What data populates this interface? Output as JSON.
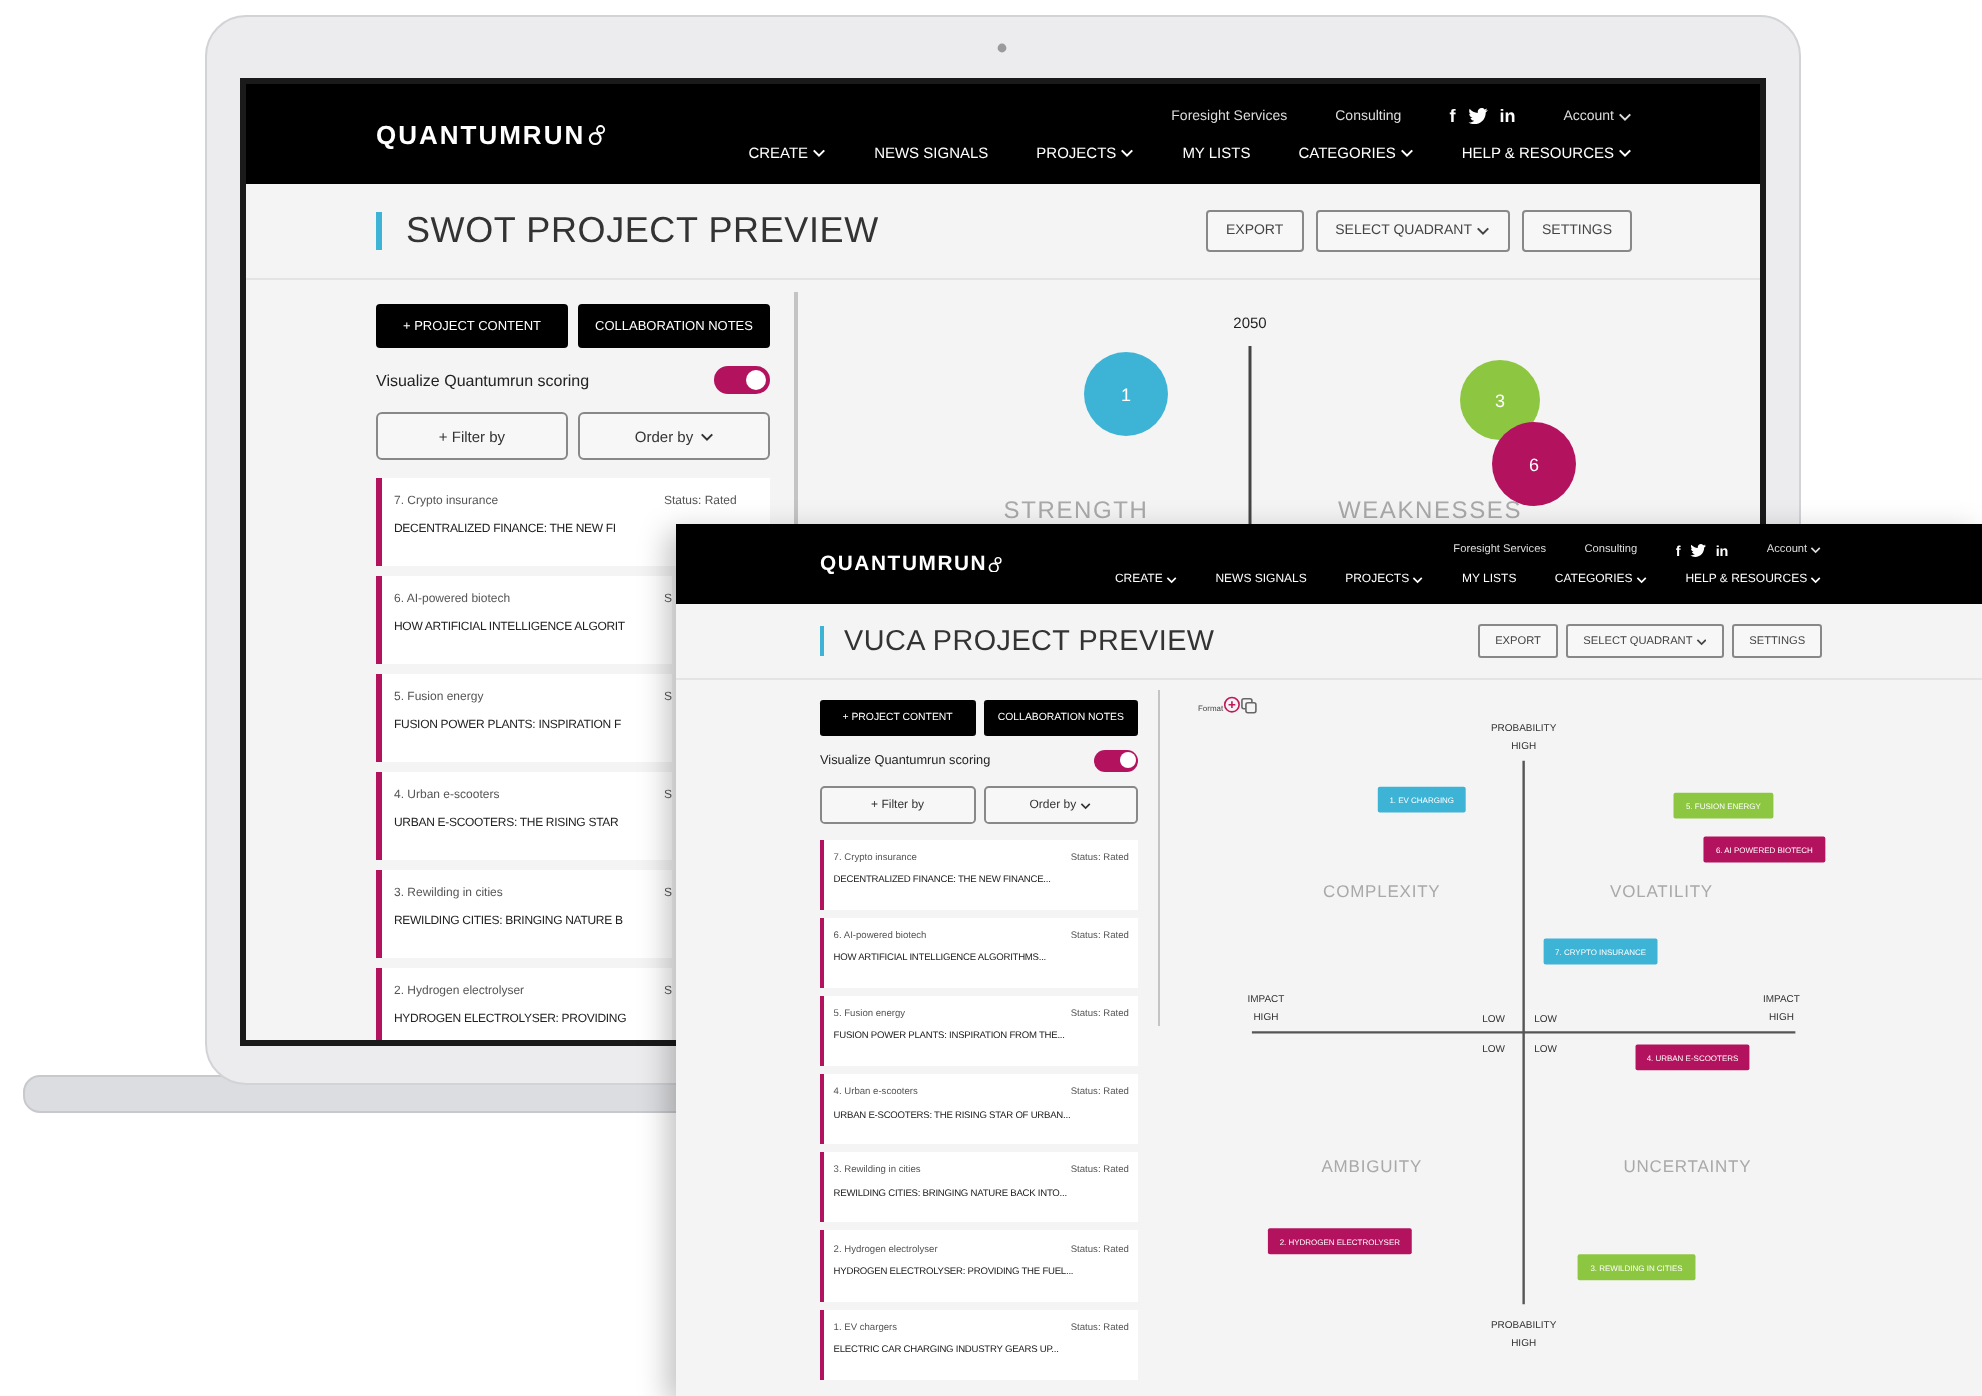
{
  "windows": [
    {
      "kind": "swot",
      "logo": "QUANTUMRUN",
      "top_links": [
        "Foresight Services",
        "Consulting"
      ],
      "social": [
        {
          "kind": "letter",
          "label": "f"
        },
        {
          "kind": "bird"
        },
        {
          "kind": "letter",
          "label": "in"
        }
      ],
      "account": {
        "label": "Account",
        "dropdown": true
      },
      "nav": [
        {
          "label": "CREATE",
          "dropdown": true
        },
        {
          "label": "NEWS SIGNALS",
          "dropdown": false
        },
        {
          "label": "PROJECTS",
          "dropdown": true
        },
        {
          "label": "MY LISTS",
          "dropdown": false
        },
        {
          "label": "CATEGORIES",
          "dropdown": true
        },
        {
          "label": "HELP & RESOURCES",
          "dropdown": true
        }
      ],
      "title": "SWOT PROJECT PREVIEW",
      "actions": [
        {
          "label": "EXPORT",
          "dropdown": false
        },
        {
          "label": "SELECT QUADRANT",
          "dropdown": true
        },
        {
          "label": "SETTINGS",
          "dropdown": false
        }
      ],
      "panel_buttons": [
        "+ PROJECT CONTENT",
        "COLLABORATION NOTES"
      ],
      "toggle": {
        "label": "Visualize Quantumrun scoring",
        "on": true
      },
      "filter_button": "+ Filter by",
      "order_button": {
        "label": "Order by",
        "dropdown": true
      },
      "items": [
        {
          "category": "7. Crypto insurance",
          "status": "Status: Rated",
          "title": "DECENTRALIZED FINANCE: THE NEW FI"
        },
        {
          "category": "6. AI-powered biotech",
          "status": "S",
          "title": "HOW ARTIFICIAL INTELLIGENCE ALGORIT"
        },
        {
          "category": "5. Fusion energy",
          "status": "S",
          "title": "FUSION POWER PLANTS: INSPIRATION F"
        },
        {
          "category": "4. Urban e-scooters",
          "status": "S",
          "title": "URBAN E-SCOOTERS: THE RISING STAR"
        },
        {
          "category": "3. Rewilding in cities",
          "status": "S",
          "title": "REWILDING CITIES: BRINGING NATURE B"
        },
        {
          "category": "2. Hydrogen electrolyser",
          "status": "S",
          "title": "HYDROGEN ELECTROLYSER: PROVIDING"
        }
      ],
      "chart": {
        "kind": "swot",
        "year_label": "2050",
        "quadrants": [
          "STRENGTH",
          "WEAKNESSES"
        ],
        "markers": [
          {
            "label": "1",
            "color": "#3db4d6"
          },
          {
            "label": "3",
            "color": "#8dc641"
          },
          {
            "label": "6",
            "color": "#b3125f"
          }
        ]
      }
    },
    {
      "kind": "vuca",
      "logo": "QUANTUMRUN",
      "top_links": [
        "Foresight Services",
        "Consulting"
      ],
      "social": [
        {
          "kind": "letter",
          "label": "f"
        },
        {
          "kind": "bird"
        },
        {
          "kind": "letter",
          "label": "in"
        }
      ],
      "account": {
        "label": "Account",
        "dropdown": true
      },
      "nav": [
        {
          "label": "CREATE",
          "dropdown": true
        },
        {
          "label": "NEWS SIGNALS",
          "dropdown": false
        },
        {
          "label": "PROJECTS",
          "dropdown": true
        },
        {
          "label": "MY LISTS",
          "dropdown": false
        },
        {
          "label": "CATEGORIES",
          "dropdown": true
        },
        {
          "label": "HELP & RESOURCES",
          "dropdown": true
        }
      ],
      "title": "VUCA PROJECT PREVIEW",
      "actions": [
        {
          "label": "EXPORT",
          "dropdown": false
        },
        {
          "label": "SELECT QUADRANT",
          "dropdown": true
        },
        {
          "label": "SETTINGS",
          "dropdown": false
        }
      ],
      "panel_buttons": [
        "+ PROJECT CONTENT",
        "COLLABORATION NOTES"
      ],
      "toggle": {
        "label": "Visualize Quantumrun scoring",
        "on": true
      },
      "filter_button": "+ Filter by",
      "order_button": {
        "label": "Order by",
        "dropdown": true
      },
      "items": [
        {
          "category": "7. Crypto insurance",
          "status": "Status: Rated",
          "title": "DECENTRALIZED FINANCE: THE NEW FINANCE..."
        },
        {
          "category": "6. AI-powered biotech",
          "status": "Status: Rated",
          "title": "HOW ARTIFICIAL INTELLIGENCE ALGORITHMS..."
        },
        {
          "category": "5. Fusion energy",
          "status": "Status: Rated",
          "title": "FUSION POWER PLANTS: INSPIRATION FROM THE..."
        },
        {
          "category": "4. Urban e-scooters",
          "status": "Status: Rated",
          "title": "URBAN E-SCOOTERS: THE RISING STAR OF URBAN..."
        },
        {
          "category": "3. Rewilding in cities",
          "status": "Status: Rated",
          "title": "REWILDING CITIES: BRINGING NATURE BACK INTO..."
        },
        {
          "category": "2. Hydrogen electrolyser",
          "status": "Status: Rated",
          "title": "HYDROGEN ELECTROLYSER: PROVIDING THE FUEL..."
        },
        {
          "category": "1. EV chargers",
          "status": "Status: Rated",
          "title": "ELECTRIC CAR CHARGING INDUSTRY GEARS UP..."
        }
      ],
      "chart": {
        "kind": "vuca",
        "format_label": "Format",
        "top_axis": [
          "PROBABILITY",
          "HIGH"
        ],
        "bottom_axis": [
          "PROBABILITY",
          "HIGH"
        ],
        "left_axis": [
          "IMPACT",
          "HIGH"
        ],
        "right_axis": [
          "IMPACT",
          "HIGH"
        ],
        "low_labels": [
          "LOW",
          "LOW",
          "LOW",
          "LOW"
        ],
        "quadrants": [
          "COMPLEXITY",
          "VOLATILITY",
          "AMBIGUITY",
          "UNCERTAINTY"
        ],
        "tags": [
          {
            "label": "1. EV CHARGING",
            "color": "#3db4d6"
          },
          {
            "label": "5. FUSION ENERGY",
            "color": "#8dc641"
          },
          {
            "label": "6. AI POWERED BIOTECH",
            "color": "#b3125f"
          },
          {
            "label": "7. CRYPTO INSURANCE",
            "color": "#3db4d6"
          },
          {
            "label": "4. URBAN E-SCOOTERS",
            "color": "#b3125f"
          },
          {
            "label": "2. HYDROGEN ELECTROLYSER",
            "color": "#b3125f"
          },
          {
            "label": "3. REWILDING IN CITIES",
            "color": "#8dc641"
          }
        ]
      }
    }
  ]
}
